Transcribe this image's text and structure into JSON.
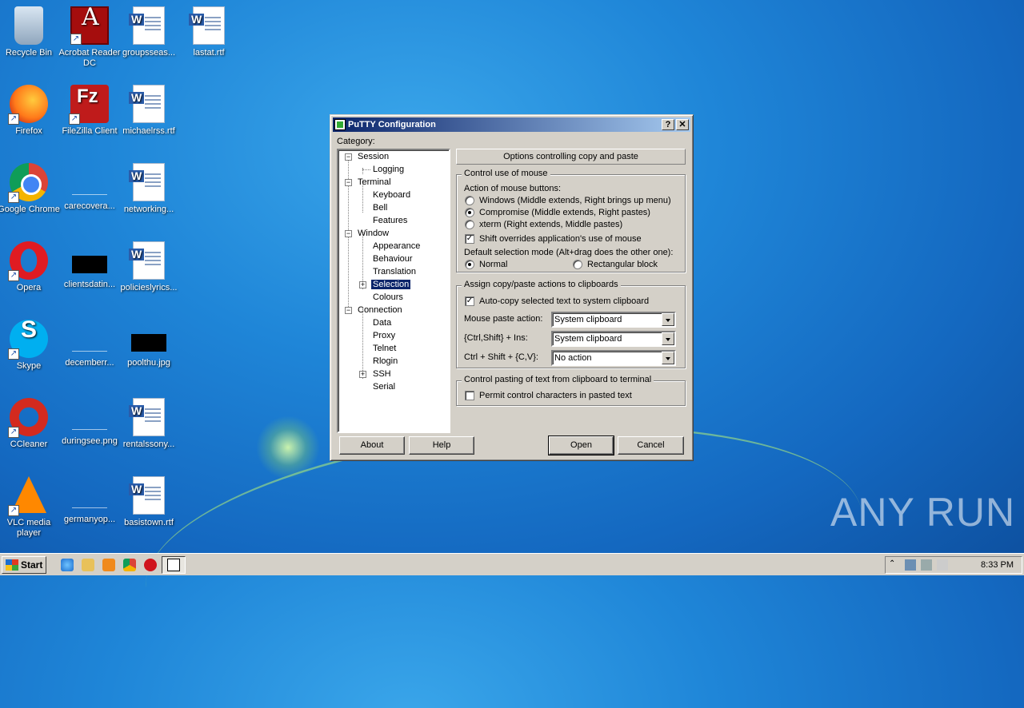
{
  "desktop": {
    "icons": [
      {
        "label": "Recycle Bin"
      },
      {
        "label": "Acrobat Reader DC"
      },
      {
        "label": "groupsseas..."
      },
      {
        "label": "lastat.rtf"
      },
      {
        "label": "Firefox"
      },
      {
        "label": "FileZilla Client"
      },
      {
        "label": "michaelrss.rtf"
      },
      {
        "label": "Google Chrome"
      },
      {
        "label": "carecovera..."
      },
      {
        "label": "networking..."
      },
      {
        "label": "Opera"
      },
      {
        "label": "clientsdatin..."
      },
      {
        "label": "policieslyrics..."
      },
      {
        "label": "Skype"
      },
      {
        "label": "decemberr..."
      },
      {
        "label": "poolthu.jpg"
      },
      {
        "label": "CCleaner"
      },
      {
        "label": "duringsee.png"
      },
      {
        "label": "rentalssony..."
      },
      {
        "label": "VLC media player"
      },
      {
        "label": "germanyop..."
      },
      {
        "label": "basistown.rtf"
      }
    ],
    "watermark": "ANY RUN"
  },
  "window": {
    "title": "PuTTY Configuration",
    "help_btn": "?",
    "close_btn": "✕",
    "category_label": "Category:",
    "tree": [
      {
        "label": "Session"
      },
      {
        "label": "Logging"
      },
      {
        "label": "Terminal"
      },
      {
        "label": "Keyboard"
      },
      {
        "label": "Bell"
      },
      {
        "label": "Features"
      },
      {
        "label": "Window"
      },
      {
        "label": "Appearance"
      },
      {
        "label": "Behaviour"
      },
      {
        "label": "Translation"
      },
      {
        "label": "Selection"
      },
      {
        "label": "Colours"
      },
      {
        "label": "Connection"
      },
      {
        "label": "Data"
      },
      {
        "label": "Proxy"
      },
      {
        "label": "Telnet"
      },
      {
        "label": "Rlogin"
      },
      {
        "label": "SSH"
      },
      {
        "label": "Serial"
      }
    ],
    "panel_header": "Options controlling copy and paste",
    "mouse_group": {
      "title": "Control use of mouse",
      "action_label": "Action of mouse buttons:",
      "opt_windows": "Windows (Middle extends, Right brings up menu)",
      "opt_compromise": "Compromise (Middle extends, Right pastes)",
      "opt_xterm": "xterm (Right extends, Middle pastes)",
      "shift_override": "Shift overrides application's use of mouse",
      "default_mode_label": "Default selection mode (Alt+drag does the other one):",
      "mode_normal": "Normal",
      "mode_rect": "Rectangular block"
    },
    "clipboard_group": {
      "title": "Assign copy/paste actions to clipboards",
      "autocopy": "Auto-copy selected text to system clipboard",
      "mouse_paste_label": "Mouse paste action:",
      "mouse_paste_value": "System clipboard",
      "ctrl_shift_ins_label": "{Ctrl,Shift} + Ins:",
      "ctrl_shift_ins_value": "System clipboard",
      "ctrl_shift_cv_label": "Ctrl + Shift + {C,V}:",
      "ctrl_shift_cv_value": "No action"
    },
    "paste_group": {
      "title": "Control pasting of text from clipboard to terminal",
      "permit_ctrl": "Permit control characters in pasted text"
    },
    "buttons": {
      "about": "About",
      "help": "Help",
      "open": "Open",
      "cancel": "Cancel"
    }
  },
  "taskbar": {
    "start": "Start",
    "clock": "8:33 PM"
  }
}
